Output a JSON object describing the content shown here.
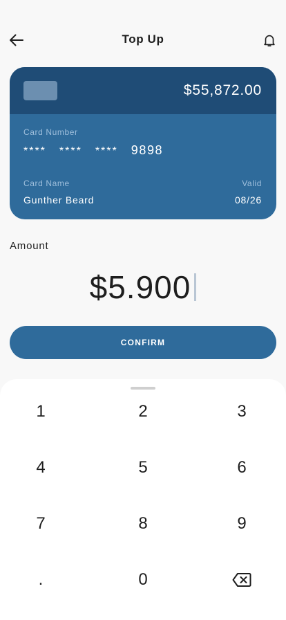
{
  "header": {
    "title": "Top Up",
    "back_icon": "arrow-left-icon",
    "notification_icon": "bell-icon"
  },
  "card": {
    "balance": "$55,872.00",
    "number_label": "Card Number",
    "number_masked": [
      "****",
      "****",
      "****"
    ],
    "number_last4": "9898",
    "name_label": "Card Name",
    "name": "Gunther Beard",
    "valid_label": "Valid",
    "valid": "08/26",
    "colors": {
      "top": "#1f4c76",
      "body": "#2f6b9b",
      "chip": "#6c8fb0"
    }
  },
  "amount": {
    "label": "Amount",
    "value": "$5.900"
  },
  "confirm": {
    "label": "CONFIRM"
  },
  "keypad": {
    "keys": [
      "1",
      "2",
      "3",
      "4",
      "5",
      "6",
      "7",
      "8",
      "9",
      ".",
      "0"
    ],
    "backspace_icon": "backspace-icon"
  },
  "colors": {
    "accent": "#2f6b9b",
    "background": "#f8f8f8"
  }
}
